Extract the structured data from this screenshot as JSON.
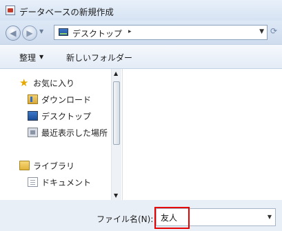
{
  "window": {
    "title": "データベースの新規作成"
  },
  "address": {
    "location": "デスクトップ",
    "separator_glyph": "▸"
  },
  "toolbar": {
    "organize": "整理",
    "new_folder": "新しいフォルダー"
  },
  "nav": {
    "favorites": {
      "label": "お気に入り",
      "items": [
        "ダウンロード",
        "デスクトップ",
        "最近表示した場所"
      ]
    },
    "libraries": {
      "label": "ライブラリ",
      "items": [
        "ドキュメント"
      ]
    }
  },
  "filename": {
    "label": "ファイル名(N):",
    "value": "友人"
  },
  "colors": {
    "highlight": "#e60000"
  }
}
